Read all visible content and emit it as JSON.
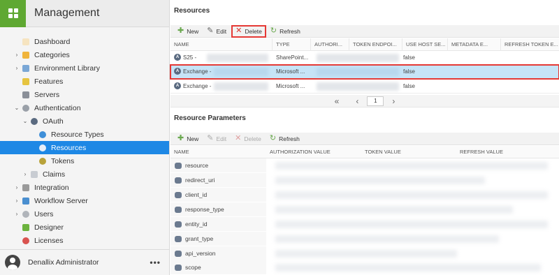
{
  "app": {
    "title": "Management"
  },
  "sidebar": {
    "items": [
      {
        "label": "Dashboard",
        "arrow": "",
        "indent": 0
      },
      {
        "label": "Categories",
        "arrow": "›",
        "indent": 0
      },
      {
        "label": "Environment Library",
        "arrow": "›",
        "indent": 0
      },
      {
        "label": "Features",
        "arrow": "",
        "indent": 0
      },
      {
        "label": "Servers",
        "arrow": "",
        "indent": 0
      },
      {
        "label": "Authentication",
        "arrow": "⌄",
        "indent": 0
      },
      {
        "label": "OAuth",
        "arrow": "⌄",
        "indent": 1
      },
      {
        "label": "Resource Types",
        "arrow": "",
        "indent": 2
      },
      {
        "label": "Resources",
        "arrow": "",
        "indent": 2
      },
      {
        "label": "Tokens",
        "arrow": "",
        "indent": 2
      },
      {
        "label": "Claims",
        "arrow": "›",
        "indent": 1
      },
      {
        "label": "Integration",
        "arrow": "›",
        "indent": 0
      },
      {
        "label": "Workflow Server",
        "arrow": "›",
        "indent": 0
      },
      {
        "label": "Users",
        "arrow": "›",
        "indent": 0
      },
      {
        "label": "Designer",
        "arrow": "",
        "indent": 0
      },
      {
        "label": "Licenses",
        "arrow": "",
        "indent": 0
      }
    ],
    "user": {
      "name": "Denallix Administrator",
      "more": "•••"
    }
  },
  "resources": {
    "title": "Resources",
    "toolbar": {
      "new": "New",
      "edit": "Edit",
      "delete": "Delete",
      "refresh": "Refresh"
    },
    "columns": [
      "NAME",
      "TYPE",
      "AUTHORI...",
      "TOKEN ENDPOI...",
      "USE HOST SE...",
      "METADATA E...",
      "REFRESH TOKEN E..."
    ],
    "rows": [
      {
        "name": "S25 -",
        "type": "SharePoint...",
        "use_host": "false"
      },
      {
        "name": "Exchange -",
        "type": "Microsoft ...",
        "use_host": "false"
      },
      {
        "name": "Exchange -",
        "type": "Microsoft ...",
        "use_host": "false"
      }
    ],
    "pager": {
      "page": "1"
    }
  },
  "params": {
    "title": "Resource Parameters",
    "toolbar": {
      "new": "New",
      "edit": "Edit",
      "delete": "Delete",
      "refresh": "Refresh"
    },
    "columns": [
      "NAME",
      "AUTHORIZATION VALUE",
      "TOKEN VALUE",
      "REFRESH VALUE"
    ],
    "rows": [
      "resource",
      "redirect_uri",
      "client_id",
      "response_type",
      "entity_id",
      "grant_type",
      "api_version",
      "scope"
    ]
  },
  "colors": {
    "accent": "#1e88e5",
    "brand": "#5fa832",
    "highlight": "#e53935",
    "selected_row": "#c6e4f7"
  }
}
